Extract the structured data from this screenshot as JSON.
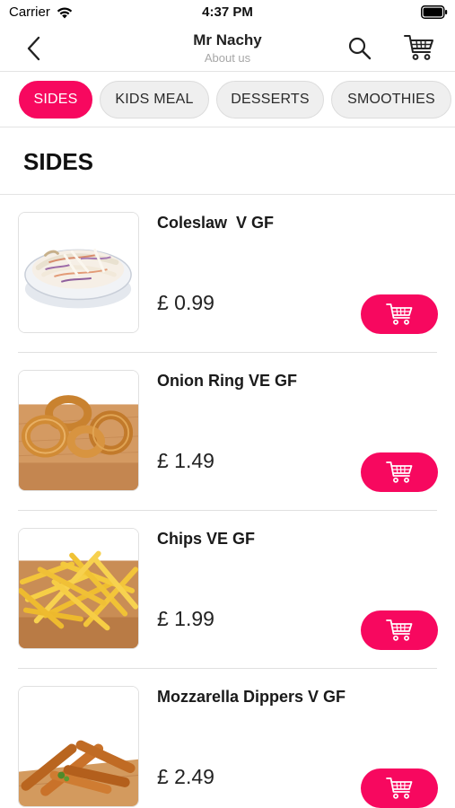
{
  "status_bar": {
    "carrier": "Carrier",
    "time": "4:37 PM"
  },
  "nav": {
    "title": "Mr Nachy",
    "subtitle": "About us"
  },
  "tabs": [
    {
      "label": "SIDES",
      "active": true
    },
    {
      "label": "KIDS MEAL",
      "active": false
    },
    {
      "label": "DESSERTS",
      "active": false
    },
    {
      "label": "SMOOTHIES",
      "active": false
    }
  ],
  "section": {
    "title": "SIDES"
  },
  "products": [
    {
      "name": "Coleslaw  V GF",
      "price": "£ 0.99",
      "image": "coleslaw-bowl"
    },
    {
      "name": "Onion Ring VE GF",
      "price": "£ 1.49",
      "image": "onion-rings"
    },
    {
      "name": "Chips VE GF",
      "price": "£ 1.99",
      "image": "chips"
    },
    {
      "name": "Mozzarella Dippers V GF",
      "price": "£ 2.49",
      "image": "mozzarella-dippers"
    }
  ],
  "colors": {
    "accent": "#f7085f",
    "divider": "#e0e0e0",
    "subtitle": "#a7a7a7"
  }
}
